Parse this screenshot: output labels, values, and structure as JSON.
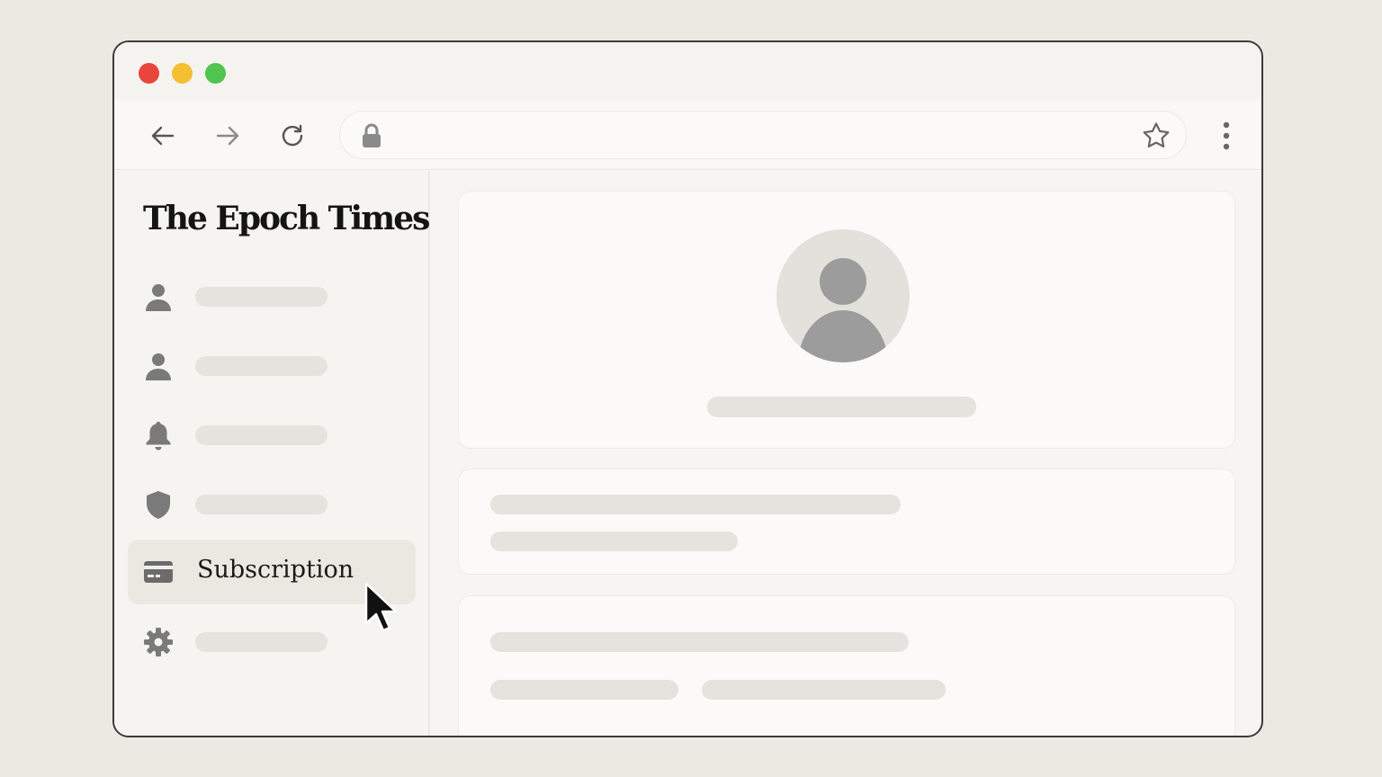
{
  "window": {
    "traffic_lights": {
      "close": "#e8453c",
      "minimize": "#f4bf30",
      "maximize": "#4fc44f"
    }
  },
  "toolbar": {
    "back_icon": "arrow-left",
    "forward_icon": "arrow-right",
    "reload_icon": "reload",
    "lock_icon": "lock",
    "bookmark_icon": "star-outline",
    "menu_icon": "vertical-dots"
  },
  "sidebar": {
    "brand": "The Epoch Times",
    "items": [
      {
        "icon": "person-icon",
        "label": ""
      },
      {
        "icon": "person-icon",
        "label": ""
      },
      {
        "icon": "bell-icon",
        "label": ""
      },
      {
        "icon": "shield-icon",
        "label": ""
      },
      {
        "icon": "credit-card-icon",
        "label": "Subscription",
        "active": true
      },
      {
        "icon": "gear-icon",
        "label": ""
      }
    ]
  },
  "colors": {
    "page_background": "#ebe9e1",
    "skeleton": "#e5e3de",
    "icon_gray": "#7a7a7a",
    "active_item": "#ebe8e2"
  }
}
